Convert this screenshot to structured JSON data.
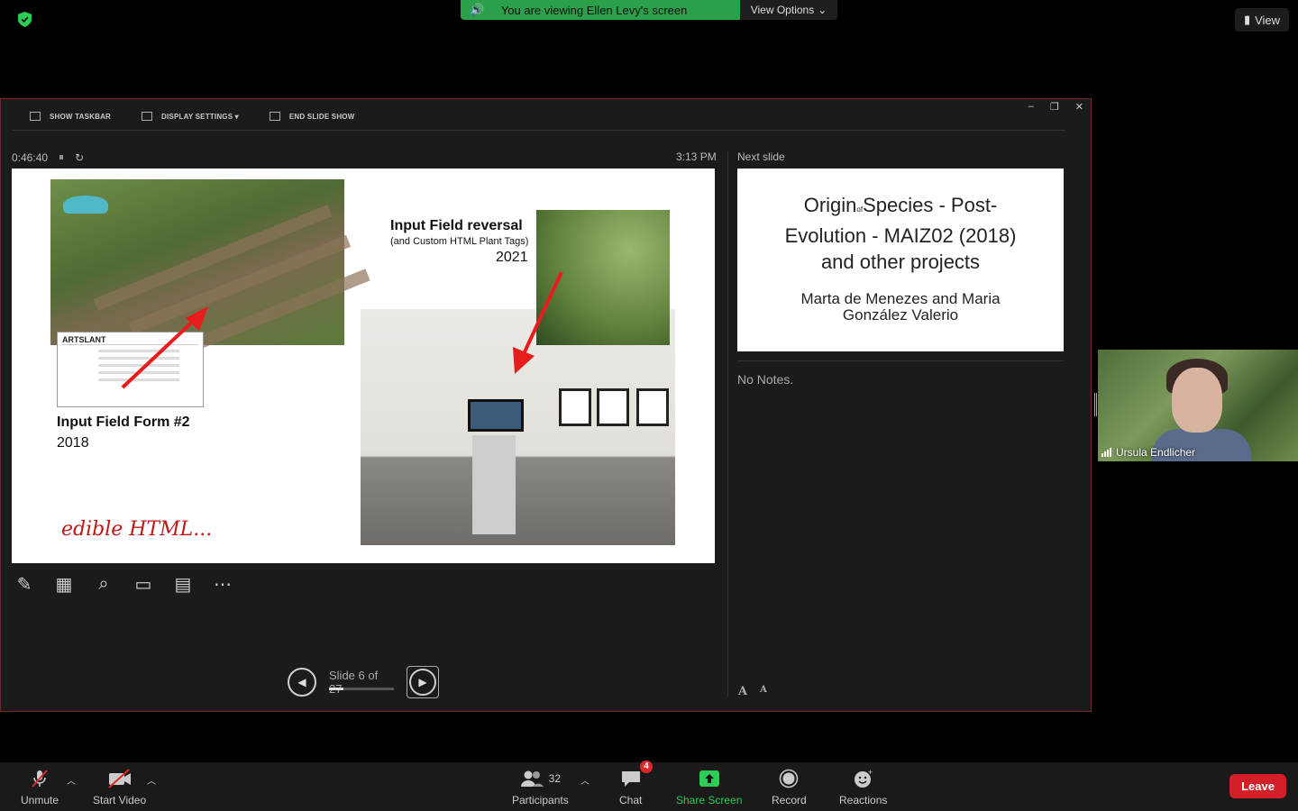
{
  "banner": {
    "viewing_text": "You are viewing Ellen Levy's screen",
    "view_options_label": "View Options",
    "view_button_label": "View",
    "accent_color": "#2aa04a"
  },
  "presenter": {
    "toolbar": {
      "show_taskbar": "SHOW TASKBAR",
      "display_settings": "DISPLAY SETTINGS ▾",
      "end_slide_show": "END SLIDE SHOW"
    },
    "elapsed_time": "0:46:40",
    "clock": "3:13 PM",
    "current_slide": {
      "form_brand": "ARTSLANT",
      "form_title": "Input Field Form #2",
      "form_year": "2018",
      "edible": "edible HTML...",
      "reversal_title": "Input Field reversal",
      "reversal_subtitle": "(and Custom HTML Plant Tags)",
      "reversal_year": "2021"
    },
    "slide_counter": "Slide 6 of 27",
    "slide_progress": 0.22,
    "next_slide_label": "Next slide",
    "next_slide": {
      "title_part1": "Origin",
      "title_of": "of",
      "title_part2": "Species - Post-",
      "title_line2": "Evolution - MAIZ02 (2018)",
      "title_line3": "and other projects",
      "authors_line1": "Marta de Menezes and Maria",
      "authors_line2": "González Valerio"
    },
    "notes": "No Notes."
  },
  "participant_video": {
    "name": "Ursula Endlicher"
  },
  "bottom_bar": {
    "unmute": "Unmute",
    "start_video": "Start Video",
    "participants": "Participants",
    "participants_count": "32",
    "chat": "Chat",
    "chat_badge": "4",
    "share_screen": "Share Screen",
    "record": "Record",
    "reactions": "Reactions",
    "leave": "Leave"
  }
}
